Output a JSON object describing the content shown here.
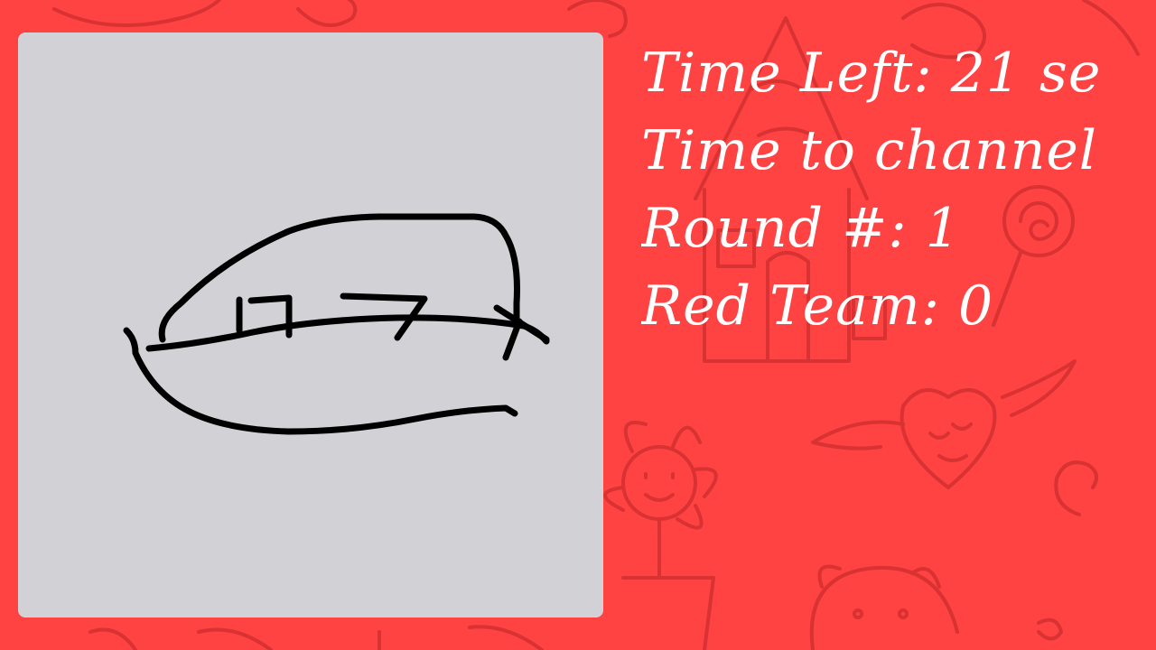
{
  "background": {
    "color": "#ff4242",
    "doodle_color": "#d93232",
    "doodles": [
      "flower-doodle",
      "house-doodle",
      "heart-wings-doodle",
      "lollipop-doodle",
      "pig-doodle",
      "candy-doodle",
      "swirl-doodle"
    ]
  },
  "canvas": {
    "background": "#d1d1d6",
    "stroke_color": "#000000",
    "drawing": "player-sketch"
  },
  "status": {
    "time_left": "Time Left: 21 se",
    "time_to_channel": "Time to channel",
    "round": "Round #: 1",
    "red_team": "Red Team: 0",
    "text_color": "#ffffff"
  }
}
